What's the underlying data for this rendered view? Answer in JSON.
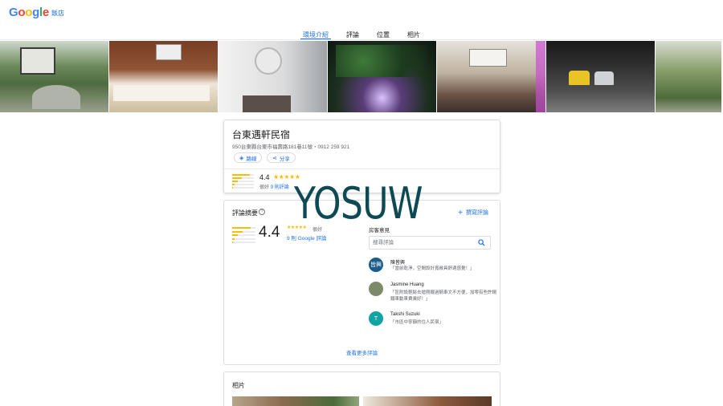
{
  "header": {
    "logo_letters": [
      "G",
      "o",
      "o",
      "g",
      "l",
      "e"
    ],
    "hotel_tag": "飯店"
  },
  "tabs": [
    "環境介紹",
    "評論",
    "位置",
    "相片"
  ],
  "active_tab": 0,
  "photo_strip": {
    "count": 7
  },
  "hotel": {
    "name": "台東遇軒民宿",
    "address": "950台東縣台東市福壽路181巷11號・0912 259 921",
    "route_label": "路線",
    "share_label": "分享",
    "rating": "4.4",
    "stars": "★★★★★",
    "rating_word": "很好",
    "review_link": "9 則評論",
    "bars": [
      0.8,
      0.45,
      0.25,
      0.1,
      0.05
    ]
  },
  "reviews": {
    "title": "評論摘要",
    "help": "?",
    "write_label": "撰寫評論",
    "rating": "4.4",
    "stars": "★★★★★",
    "rating_word": "很好",
    "count_link": "9 則 Google 評論",
    "bars": [
      0.8,
      0.45,
      0.25,
      0.1,
      0.05
    ],
    "guest_title": "房客意見",
    "search_placeholder": "搜尋評論",
    "items": [
      {
        "initials": "皆興",
        "name": "陳皆興",
        "text": "「當前乾淨，空間設計寬敞具舒適感覺！」",
        "avatar_color": "#1a5c8a"
      },
      {
        "initials": "",
        "name": "Jasmine Huang",
        "text": "「區附設輕鬆去搶剛擺過騎車文不方便，加零有些許鍋鐵車動車費乘好！」",
        "avatar_color": "#7d8a6a"
      },
      {
        "initials": "T",
        "name": "Takshi Suzuki",
        "text": "「市區中寧靜的住人民宿」",
        "avatar_color": "#12a4a4"
      }
    ],
    "more_label": "查看更多評論"
  },
  "photos": {
    "title": "相片"
  },
  "watermark": "YOSUW",
  "colors": {
    "accent": "#1a73e8",
    "star": "#fbbc04",
    "watermark": "#0d4a54"
  }
}
